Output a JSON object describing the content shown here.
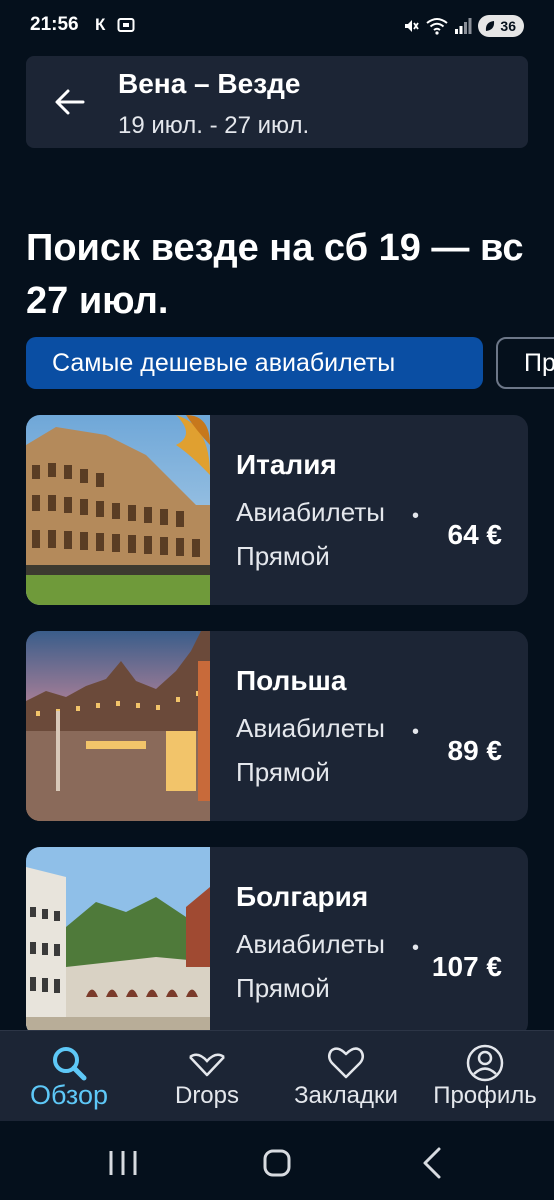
{
  "status_bar": {
    "time": "21:56",
    "carrier_letter": "К",
    "battery_level": "36"
  },
  "header": {
    "route": "Вена – Везде",
    "dates": "19 июл. - 27 июл."
  },
  "page_title": "Поиск везде на сб 19 — вс 27 июл.",
  "filters": {
    "active": "Самые дешевые авиабилеты",
    "next_partial": "Пр"
  },
  "results": [
    {
      "country": "Италия",
      "type": "Авиабилеты",
      "stops": "Прямой",
      "price": "64 €"
    },
    {
      "country": "Польша",
      "type": "Авиабилеты",
      "stops": "Прямой",
      "price": "89 €"
    },
    {
      "country": "Болгария",
      "type": "Авиабилеты",
      "stops": "Прямой",
      "price": "107 €"
    }
  ],
  "tab_bar": {
    "explore": "Обзор",
    "drops": "Drops",
    "bookmarks": "Закладки",
    "profile": "Профиль"
  },
  "colors": {
    "background": "#05101c",
    "card": "#1c2535",
    "accent_chip": "#0a4ea3",
    "active_tab": "#5ec8f7"
  }
}
